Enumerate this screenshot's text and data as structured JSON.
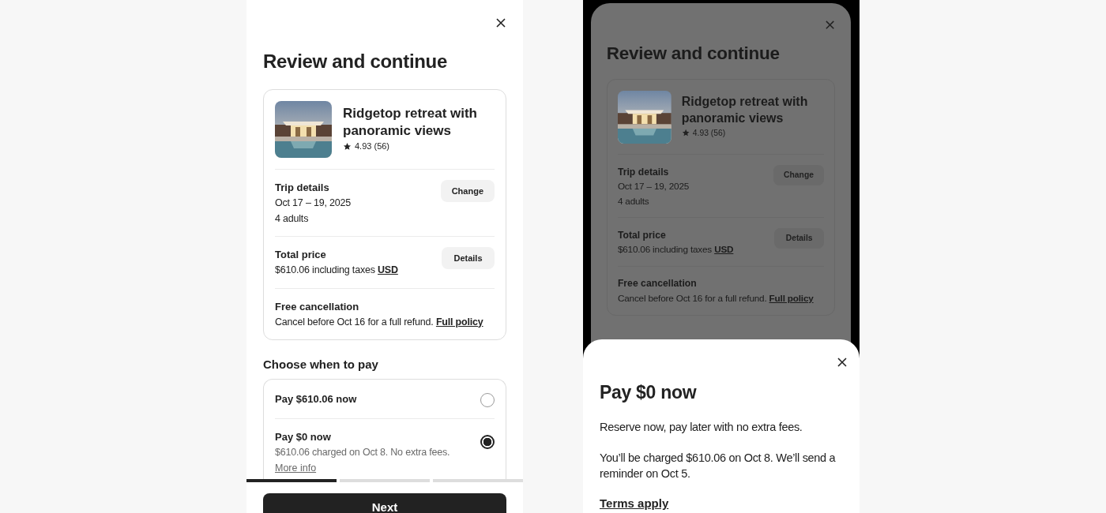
{
  "left_screen": {
    "title": "Review and continue",
    "listing": {
      "title": "Ridgetop retreat with panoramic views",
      "rating": "4.93 (56)"
    },
    "details": [
      {
        "label": "Trip details",
        "lines": [
          "Oct 17 – 19, 2025",
          "4 adults"
        ],
        "button": "Change"
      },
      {
        "label": "Total price",
        "lines": [
          "$610.06 including taxes"
        ],
        "link": "USD",
        "button": "Details"
      },
      {
        "label": "Free cancellation",
        "lines": [
          "Cancel before Oct 16 for a full refund."
        ],
        "link": "Full policy"
      }
    ],
    "pay_heading": "Choose when to pay",
    "pay_options": [
      {
        "title": "Pay $610.06 now",
        "selected": false
      },
      {
        "title": "Pay $0 now",
        "note": "$610.06 charged on Oct 8. No extra fees.",
        "link": "More info",
        "selected": true
      }
    ],
    "progress": [
      {
        "done": true
      },
      {
        "done": false
      },
      {
        "done": false
      }
    ],
    "next_button": "Next"
  },
  "right_screen": {
    "review": {
      "title": "Review and continue",
      "listing": {
        "title": "Ridgetop retreat with panoramic views",
        "rating": "4.93 (56)"
      },
      "details": [
        {
          "label": "Trip details",
          "lines": [
            "Oct 17 – 19, 2025",
            "4 adults"
          ],
          "button": "Change"
        },
        {
          "label": "Total price",
          "lines": [
            "$610.06 including taxes"
          ],
          "link": "USD",
          "button": "Details"
        },
        {
          "label": "Free cancellation",
          "lines": [
            "Cancel before Oct 16 for a full refund."
          ],
          "link": "Full policy"
        }
      ]
    },
    "modal": {
      "title": "Pay $0 now",
      "paragraphs": [
        "Reserve now, pay later with no extra fees.",
        "You’ll be charged $610.06 on Oct 8. We’ll send a reminder on Oct 5."
      ],
      "link": "Terms apply"
    }
  }
}
